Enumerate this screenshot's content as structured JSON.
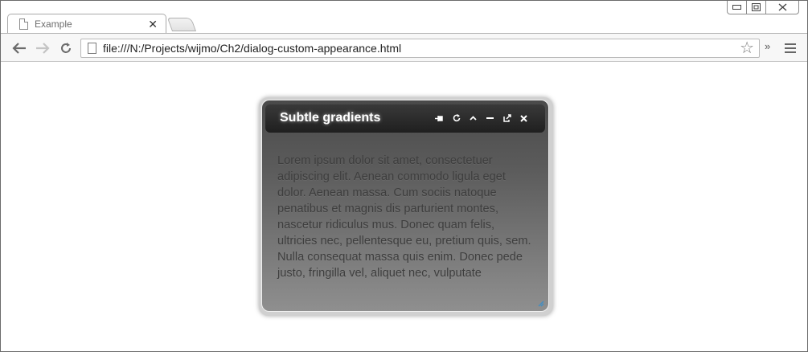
{
  "browser": {
    "tab_title": "Example",
    "tab_close_glyph": "✕",
    "url": "file:///N:/Projects/wijmo/Ch2/dialog-custom-appearance.html",
    "extensions_glyph": "»",
    "window_controls": {
      "minimize_glyph": "▭",
      "restore_glyph": "▣",
      "close_glyph": "✕"
    }
  },
  "dialog": {
    "title": "Subtle gradients",
    "body_text": "Lorem ipsum dolor sit amet, consectetuer adipiscing elit. Aenean commodo ligula eget dolor. Aenean massa. Cum sociis natoque penatibus et magnis dis parturient montes, nascetur ridiculus mus. Donec quam felis, ultricies nec, pellentesque eu, pretium quis, sem. Nulla consequat massa quis enim. Donec pede justo, fringilla vel, aliquet nec, vulputate",
    "tools": {
      "pin_icon": "pin-icon",
      "refresh_icon": "refresh-icon",
      "collapse_icon": "collapse-icon",
      "minimize_icon": "minimize-icon",
      "maximize_icon": "maximize-icon",
      "close_icon": "close-icon"
    }
  },
  "colors": {
    "titlebar": "#1f1f1f",
    "dialog_top": "#4a4a4a",
    "dialog_bottom": "#8f8f8f",
    "grip_accent": "#3a8ec8"
  }
}
